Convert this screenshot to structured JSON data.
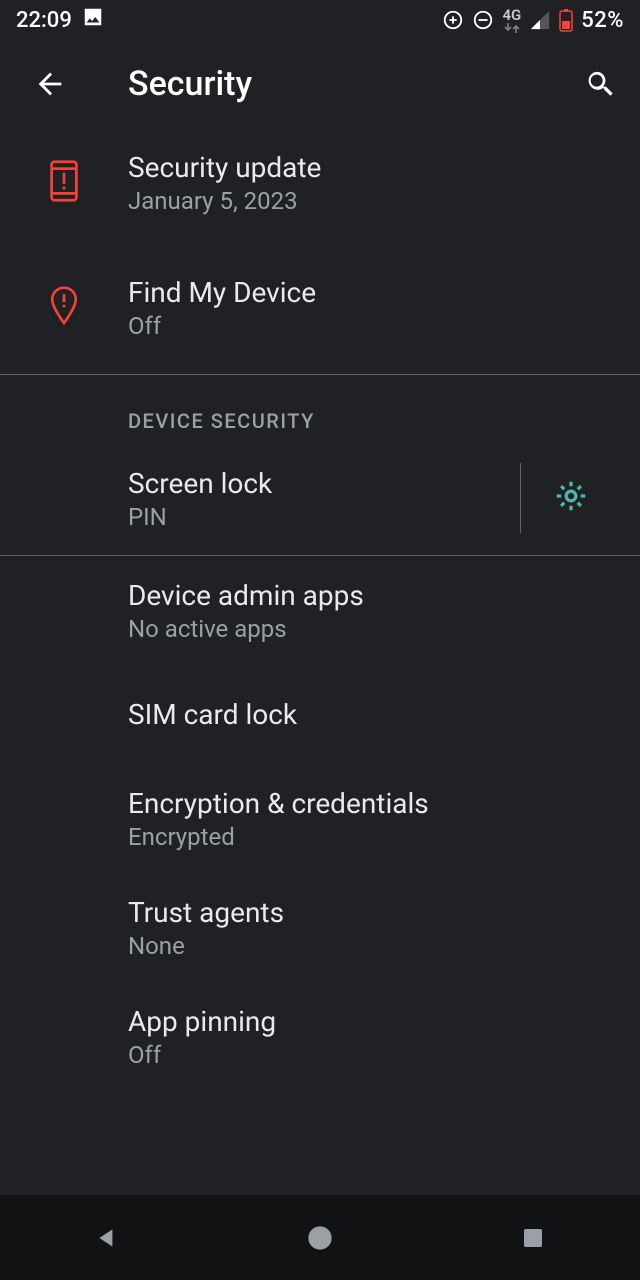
{
  "status": {
    "time": "22:09",
    "network_label": "4G",
    "battery_text": "52%"
  },
  "appbar": {
    "title": "Security"
  },
  "sections": {
    "security_update": {
      "title": "Security update",
      "subtitle": "January 5, 2023"
    },
    "find_my_device": {
      "title": "Find My Device",
      "subtitle": "Off"
    },
    "device_security_header": "DEVICE SECURITY",
    "screen_lock": {
      "title": "Screen lock",
      "subtitle": "PIN"
    },
    "device_admin": {
      "title": "Device admin apps",
      "subtitle": "No active apps"
    },
    "sim_lock": {
      "title": "SIM card lock"
    },
    "encryption": {
      "title": "Encryption & credentials",
      "subtitle": "Encrypted"
    },
    "trust_agents": {
      "title": "Trust agents",
      "subtitle": "None"
    },
    "app_pinning": {
      "title": "App pinning",
      "subtitle": "Off"
    }
  }
}
